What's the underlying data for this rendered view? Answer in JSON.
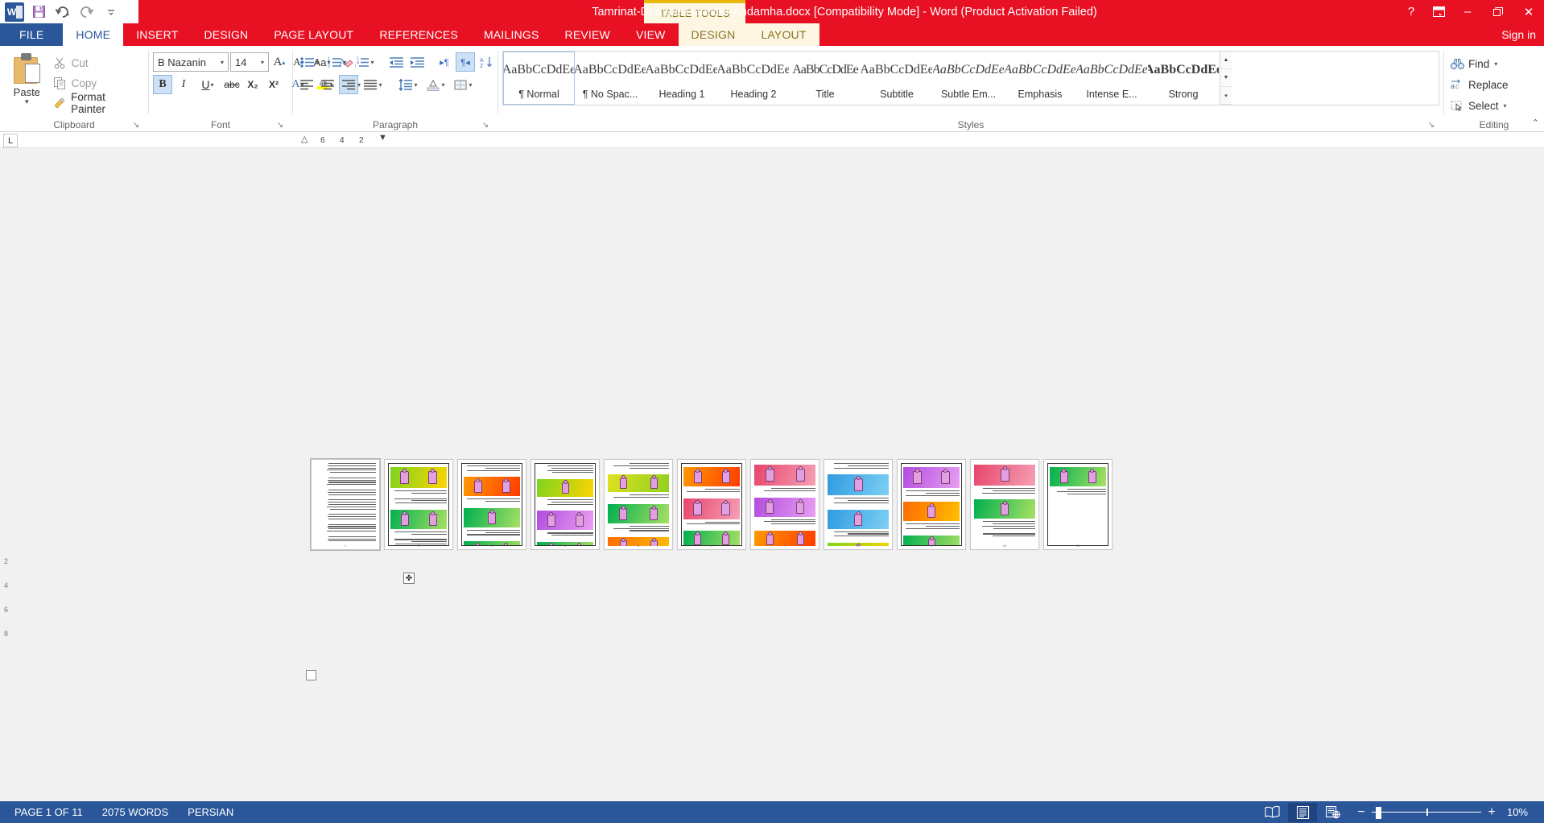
{
  "titlebar": {
    "quick_access": [
      {
        "name": "word-logo",
        "label": "W"
      },
      {
        "name": "save-icon",
        "label": "💾"
      },
      {
        "name": "undo-icon",
        "label": "↶"
      },
      {
        "name": "redo-icon",
        "label": "↻"
      },
      {
        "name": "customize-qat-icon",
        "label": "▾"
      }
    ],
    "context_tab_group": "TABLE TOOLS",
    "document_title": "Tamrinat-Damate-Harekati-Andamha.docx [Compatibility Mode]  -  Word (Product Activation Failed)",
    "help_label": "?",
    "ribbon_display_label": "⬛",
    "minimize_label": "–",
    "restore_label": "❐",
    "close_label": "✕"
  },
  "tabs": {
    "file": "FILE",
    "items": [
      {
        "label": "HOME",
        "active": true,
        "ctx": false
      },
      {
        "label": "INSERT",
        "active": false,
        "ctx": false
      },
      {
        "label": "DESIGN",
        "active": false,
        "ctx": false
      },
      {
        "label": "PAGE LAYOUT",
        "active": false,
        "ctx": false
      },
      {
        "label": "REFERENCES",
        "active": false,
        "ctx": false
      },
      {
        "label": "MAILINGS",
        "active": false,
        "ctx": false
      },
      {
        "label": "REVIEW",
        "active": false,
        "ctx": false
      },
      {
        "label": "VIEW",
        "active": false,
        "ctx": false
      },
      {
        "label": "DESIGN",
        "active": false,
        "ctx": true
      },
      {
        "label": "LAYOUT",
        "active": false,
        "ctx": true
      }
    ],
    "signin": "Sign in"
  },
  "ribbon": {
    "clipboard": {
      "group_label": "Clipboard",
      "paste_label": "Paste",
      "paste_caret": "▾",
      "commands": [
        {
          "name": "cut",
          "label": "Cut",
          "icon": "scissors-icon",
          "glyph": "✂",
          "enabled": false
        },
        {
          "name": "copy",
          "label": "Copy",
          "icon": "copy-icon",
          "glyph": "⧉",
          "enabled": false
        },
        {
          "name": "format-painter",
          "label": "Format Painter",
          "icon": "paintbrush-icon",
          "glyph": "🖌",
          "enabled": true
        }
      ],
      "launcher": "↘"
    },
    "font": {
      "group_label": "Font",
      "font_name": "B Nazanin",
      "font_size": "14",
      "grow_font": "A",
      "shrink_font": "A",
      "change_case": "Aa",
      "clear_formatting": "A",
      "bold": "B",
      "italic": "I",
      "underline": "U",
      "strikethrough": "abc",
      "subscript": "X₂",
      "superscript": "X²",
      "text_effects": "A",
      "highlight": "ab",
      "font_color": "A",
      "highlight_color": "#FFFF00",
      "font_color_swatch": "#E81123",
      "launcher": "↘"
    },
    "paragraph": {
      "group_label": "Paragraph",
      "bullets": "bullets-icon",
      "numbering": "numbering-icon",
      "multilevel": "multilevel-list-icon",
      "decrease_indent": "decrease-indent-icon",
      "increase_indent": "increase-indent-icon",
      "ltr": "▸¶",
      "rtl": "¶◂",
      "sort": "sort-icon",
      "show_marks": "¶",
      "align_left": "align-left-icon",
      "align_center": "align-center-icon",
      "align_right": "align-right-icon",
      "justify": "justify-icon",
      "line_spacing": "line-spacing-icon",
      "shading": "shading-icon",
      "borders": "borders-icon",
      "launcher": "↘"
    },
    "styles": {
      "group_label": "Styles",
      "launcher": "↘",
      "items": [
        {
          "preview": "AaBbCcDdEe",
          "name": "¶ Normal",
          "cls": "sp-normal",
          "selected": true
        },
        {
          "preview": "AaBbCcDdEe",
          "name": "¶ No Spac...",
          "cls": "sp-nospace",
          "selected": false
        },
        {
          "preview": "AaBbCcDdEe",
          "name": "Heading 1",
          "cls": "sp-h1",
          "selected": false
        },
        {
          "preview": "AaBbCcDdEe",
          "name": "Heading 2",
          "cls": "sp-h2",
          "selected": false
        },
        {
          "preview": "AaBbCcDdEe",
          "name": "Title",
          "cls": "sp-title",
          "selected": false
        },
        {
          "preview": "AaBbCcDdEe",
          "name": "Subtitle",
          "cls": "sp-sub",
          "selected": false
        },
        {
          "preview": "AaBbCcDdEe",
          "name": "Subtle Em...",
          "cls": "sp-subem",
          "selected": false
        },
        {
          "preview": "AaBbCcDdEe",
          "name": "Emphasis",
          "cls": "sp-emph",
          "selected": false
        },
        {
          "preview": "AaBbCcDdEe",
          "name": "Intense E...",
          "cls": "sp-intense",
          "selected": false
        },
        {
          "preview": "AaBbCcDdEe",
          "name": "Strong",
          "cls": "sp-strong",
          "selected": false
        }
      ],
      "scroll_up": "▲",
      "scroll_down": "▼",
      "more": "▾"
    },
    "editing": {
      "group_label": "Editing",
      "find": "Find",
      "find_caret": "▾",
      "replace": "Replace",
      "select": "Select",
      "select_caret": "▾"
    },
    "collapse_ribbon": "⌃"
  },
  "ruler": {
    "tab_selector": "L",
    "marks": [
      "6",
      "4",
      "2"
    ]
  },
  "canvas": {
    "vruler_marks": [
      "2",
      "4",
      "6",
      "8"
    ],
    "move_handle": "✤",
    "page_count": 11,
    "pages": [
      {
        "num": "1",
        "type": "text",
        "selected": true
      },
      {
        "num": "2",
        "type": "mixed",
        "bordered": true
      },
      {
        "num": "3",
        "type": "mixed",
        "bordered": true
      },
      {
        "num": "4",
        "type": "mixed",
        "bordered": true
      },
      {
        "num": "5",
        "type": "mixed",
        "bordered": false
      },
      {
        "num": "6",
        "type": "mixed",
        "bordered": true
      },
      {
        "num": "7",
        "type": "mixed",
        "bordered": false
      },
      {
        "num": "8",
        "type": "mixed",
        "bordered": false
      },
      {
        "num": "9",
        "type": "mixed",
        "bordered": true
      },
      {
        "num": "10",
        "type": "mixed",
        "bordered": false
      },
      {
        "num": "11",
        "type": "mixed",
        "bordered": true
      }
    ]
  },
  "statusbar": {
    "page_info": "PAGE 1 OF 11",
    "word_count": "2075 WORDS",
    "language": "PERSIAN",
    "views": [
      {
        "name": "read-mode",
        "glyph": "📖",
        "active": false
      },
      {
        "name": "print-layout",
        "glyph": "☰",
        "active": true
      },
      {
        "name": "web-layout",
        "glyph": "🌐",
        "active": false
      }
    ],
    "zoom_out": "−",
    "zoom_in": "+",
    "zoom_level": "10%"
  }
}
